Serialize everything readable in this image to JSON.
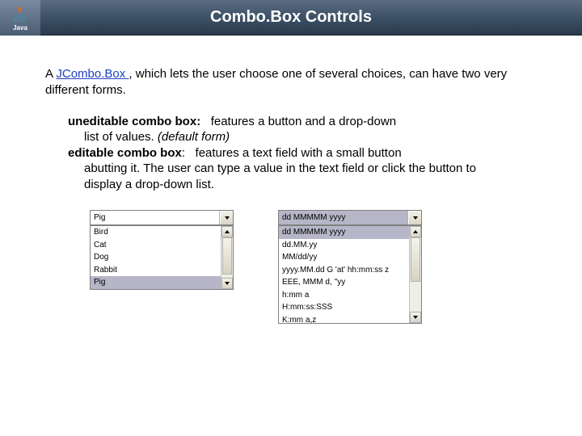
{
  "header": {
    "logo_text": "Java",
    "title": "Combo.Box Controls"
  },
  "intro": {
    "prefix": "A ",
    "link": "JCombo.Box ",
    "suffix": ", which lets the user choose one of several choices, can have two very different forms."
  },
  "defs": {
    "uneditable_title": "uneditable combo box",
    "uneditable_body1": "features a button and a drop-down",
    "uneditable_body2a": "list of values. ",
    "uneditable_body2b": "(default form)",
    "editable_title": "editable combo box",
    "editable_body1": "features a text field with a small button",
    "editable_body2": "abutting it. The user can type a value in the text field or click the button to display a drop-down list."
  },
  "combo_left": {
    "selected": "Pig",
    "items": [
      "Bird",
      "Cat",
      "Dog",
      "Rabbit",
      "Pig"
    ]
  },
  "combo_right": {
    "selected": "dd MMMMM yyyy",
    "items": [
      "dd MMMMM yyyy",
      "dd.MM.yy",
      "MM/dd/yy",
      "yyyy.MM.dd G 'at' hh:mm:ss z",
      "EEE, MMM d, ''yy",
      "h:mm a",
      "H:mm:ss:SSS",
      "K:mm a,z"
    ]
  }
}
